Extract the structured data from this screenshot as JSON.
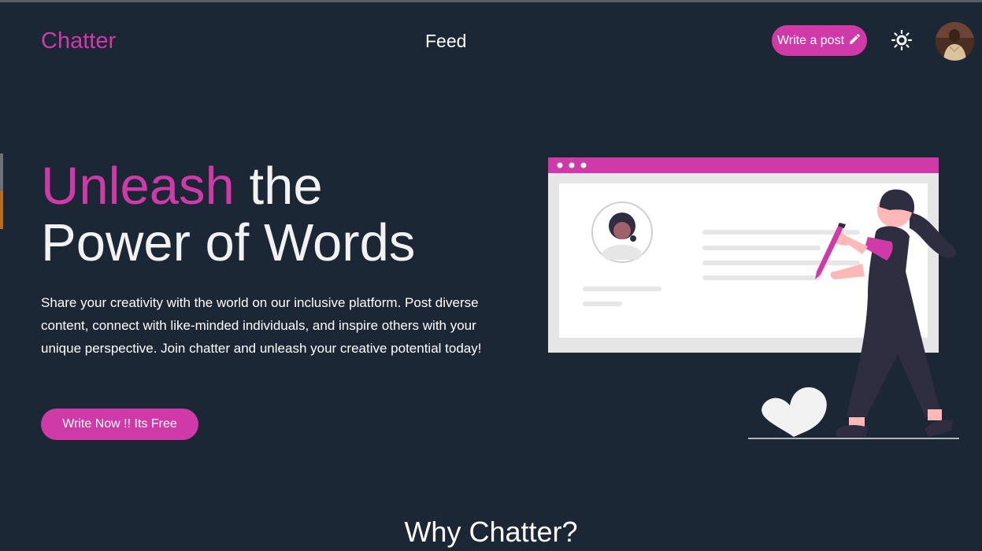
{
  "nav": {
    "logo": "Chatter",
    "feed_label": "Feed",
    "write_post_label": "Write a post",
    "write_post_icon": "pencil-icon",
    "theme_icon": "sun-icon",
    "avatar_icon": "user-avatar"
  },
  "hero": {
    "title_accent": "Unleash",
    "title_rest_line1": "the",
    "title_line2": "Power of Words",
    "description": "Share your creativity with the world on our inclusive platform. Post diverse content, connect with like-minded individuals, and inspire others with your unique perspective. Join chatter and unleash your creative potential today!",
    "cta_label": "Write Now !! Its Free"
  },
  "section": {
    "why_title": "Why Chatter?"
  },
  "colors": {
    "accent": "#cf3aa8",
    "background": "#1c2735",
    "text": "#ffffff"
  }
}
